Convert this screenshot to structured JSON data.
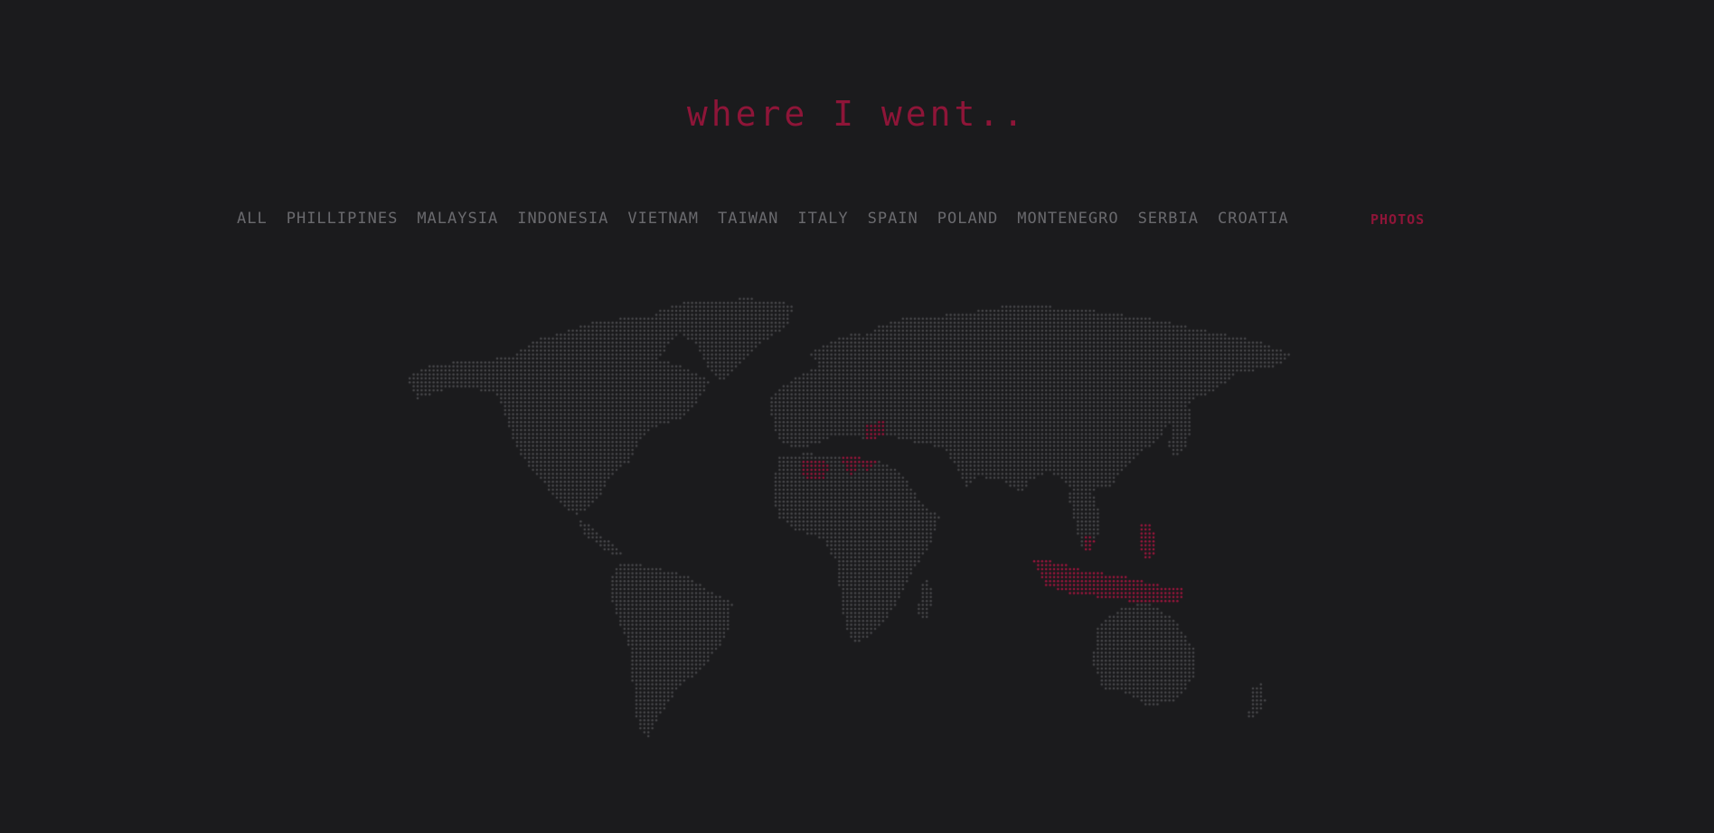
{
  "title": "where I went..",
  "nav": {
    "items": [
      {
        "label": "ALL"
      },
      {
        "label": "PHILLIPINES"
      },
      {
        "label": "MALAYSIA"
      },
      {
        "label": "INDONESIA"
      },
      {
        "label": "VIETNAM"
      },
      {
        "label": "TAIWAN"
      },
      {
        "label": "ITALY"
      },
      {
        "label": "SPAIN"
      },
      {
        "label": "POLAND"
      },
      {
        "label": "MONTENEGRO"
      },
      {
        "label": "SERBIA"
      },
      {
        "label": "CROATIA"
      }
    ],
    "photos_label": "PHOTOS"
  },
  "colors": {
    "background": "#1b1b1d",
    "accent": "#8e1538",
    "nav_text": "#6a6a6e",
    "land_dot": "#4a4a4d",
    "visited_dot": "#a3163f"
  },
  "map": {
    "visited": [
      "Philippines",
      "Malaysia",
      "Indonesia",
      "Vietnam",
      "Taiwan",
      "Italy",
      "Spain",
      "Poland",
      "Montenegro",
      "Serbia",
      "Croatia"
    ]
  }
}
